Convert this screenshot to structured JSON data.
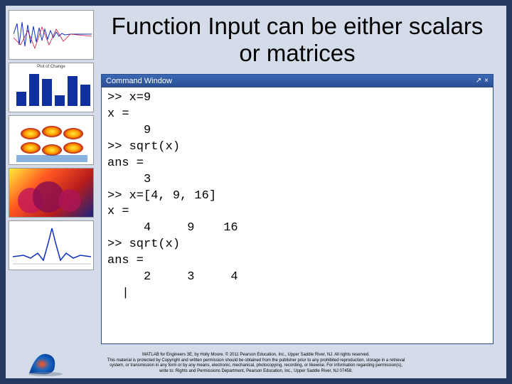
{
  "title": "Function Input can be either scalars or matrices",
  "command_window": {
    "titlebar": "Command Window",
    "lines": ">> x=9\nx =\n     9\n>> sqrt(x)\nans =\n     3\n>> x=[4, 9, 16]\nx =\n     4     9    16\n>> sqrt(x)\nans =\n     2     3     4\n  |"
  },
  "footer": {
    "line1": "MATLAB for Engineers 3E, by Holly Moore. © 2011 Pearson Education, Inc., Upper Saddle River, NJ. All rights reserved.",
    "line2": "This material is protected by Copyright and written permission should be obtained from the publisher prior to any prohibited reproduction, storage in a retrieval",
    "line3": "system, or transmission in any form or by any means, electronic, mechanical, photocopying, recording, or likewise. For information regarding permission(s),",
    "line4": "write to: Rights and Permissions Department, Pearson Education, Inc., Upper Saddle River, NJ 07458."
  },
  "sidebar_thumbs": [
    "signal-plot",
    "bar-chart",
    "surface-plot-3d",
    "fractal-image",
    "line-peak-plot"
  ]
}
